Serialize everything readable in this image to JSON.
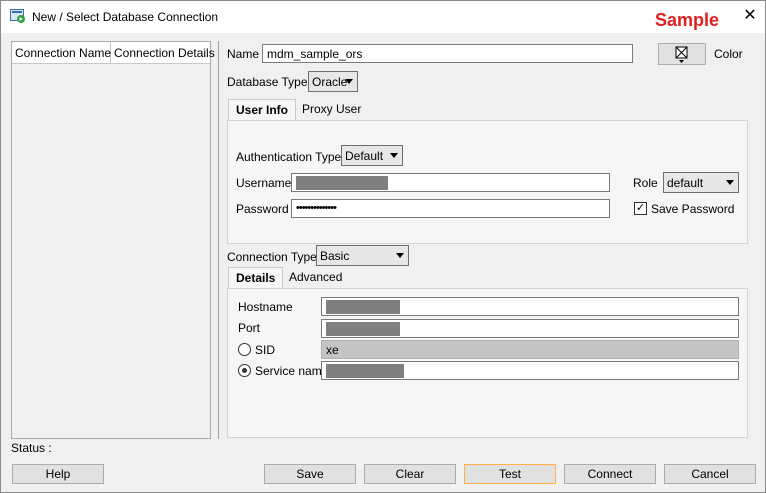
{
  "window": {
    "title": "New / Select Database Connection",
    "sample_label": "Sample",
    "close_glyph": "✕",
    "icon": "database-connection-icon"
  },
  "conn_list": {
    "headers": [
      "Connection Name",
      "Connection Details"
    ]
  },
  "form": {
    "name_label": "Name",
    "name_value": "mdm_sample_ors",
    "color_label": "Color",
    "color_icon": "color-picker-icon",
    "db_type_label": "Database Type",
    "db_type_value": "Oracle",
    "tabs": [
      "User Info",
      "Proxy User"
    ],
    "auth_type_label": "Authentication Type",
    "auth_type_value": "Default",
    "username_label": "Username",
    "password_label": "Password",
    "password_value": "••••••••••••••",
    "role_label": "Role",
    "role_value": "default",
    "save_password_label": "Save Password",
    "save_password_checked": true,
    "conn_type_label": "Connection Type",
    "conn_type_value": "Basic",
    "detail_tabs": [
      "Details",
      "Advanced"
    ],
    "hostname_label": "Hostname",
    "port_label": "Port",
    "sid_label": "SID",
    "sid_value": "xe",
    "service_name_label": "Service name",
    "selected_option": "Service name"
  },
  "status": {
    "label": "Status :"
  },
  "buttons": {
    "help": "Help",
    "save": "Save",
    "clear": "Clear",
    "test": "Test",
    "connect": "Connect",
    "cancel": "Cancel"
  }
}
